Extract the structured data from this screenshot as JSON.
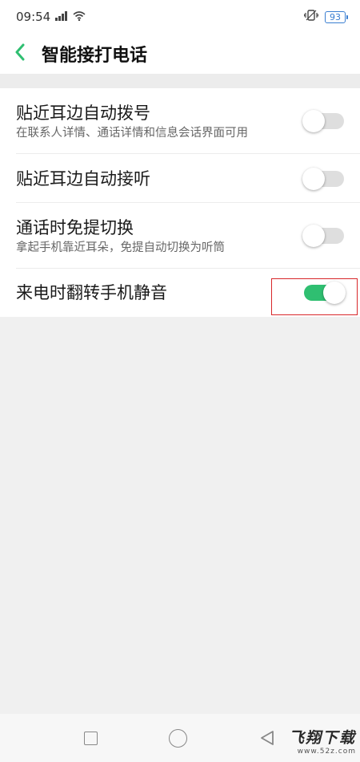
{
  "status_bar": {
    "time": "09:54",
    "signal": "⁴ᴳ",
    "battery": "93"
  },
  "header": {
    "title": "智能接打电话"
  },
  "settings": [
    {
      "title": "贴近耳边自动拨号",
      "subtitle": "在联系人详情、通话详情和信息会话界面可用",
      "enabled": false
    },
    {
      "title": "贴近耳边自动接听",
      "subtitle": "",
      "enabled": false
    },
    {
      "title": "通话时免提切换",
      "subtitle": "拿起手机靠近耳朵，免提自动切换为听筒",
      "enabled": false
    },
    {
      "title": "来电时翻转手机静音",
      "subtitle": "",
      "enabled": true
    }
  ],
  "watermark": {
    "text": "飞翔下载",
    "url": "www.52z.com"
  },
  "colors": {
    "accent": "#2fbf71",
    "highlight": "#d8272a"
  },
  "icons": {
    "back": "chevron-left-icon",
    "vibrate": "vibrate-icon",
    "wifi": "wifi-icon"
  }
}
